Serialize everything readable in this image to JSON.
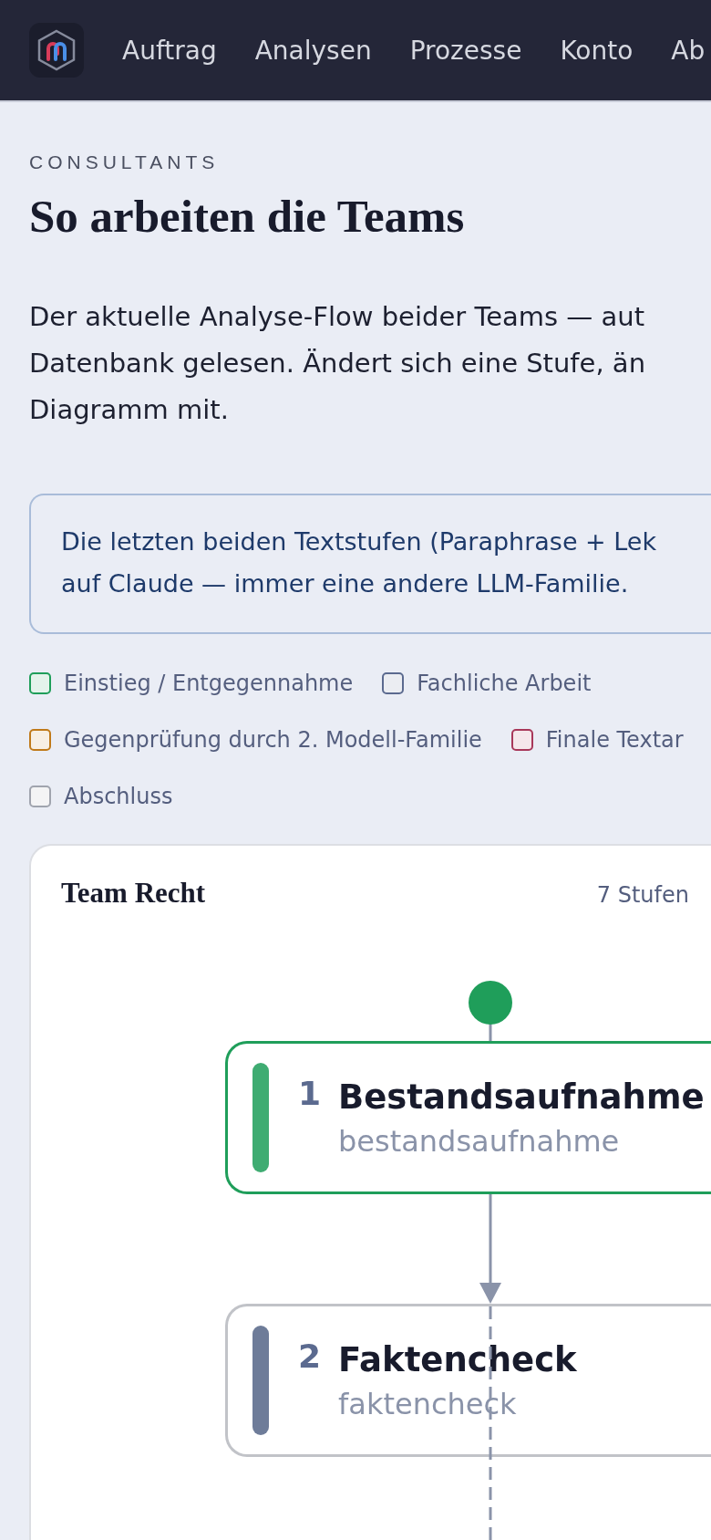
{
  "nav": {
    "items": [
      "Auftrag",
      "Analysen",
      "Prozesse",
      "Konto",
      "Ab"
    ]
  },
  "eyebrow": "CONSULTANTS",
  "title": "So arbeiten die Teams",
  "intro": [
    "Der aktuelle Analyse-Flow beider Teams — aut",
    "Datenbank gelesen. Ändert sich eine Stufe, än",
    "Diagramm mit."
  ],
  "callout": [
    "Die letzten beiden Textstufen (Paraphrase + Lek",
    "auf Claude — immer eine andere LLM-Familie."
  ],
  "legend": [
    {
      "label": "Einstieg / Entgegennahme",
      "color": "#1f9e5a"
    },
    {
      "label": "Fachliche Arbeit",
      "color": "#5b6a8f"
    },
    {
      "label": "Gegenprüfung durch 2. Modell-Familie",
      "color": "#c07a1a"
    },
    {
      "label": "Finale Textar",
      "color": "#a8385a"
    },
    {
      "label": "Abschluss",
      "color": "#a0a4ae"
    }
  ],
  "team": {
    "name": "Team Recht",
    "summary": "7 Stufen",
    "steps": [
      {
        "number": "1",
        "title": "Bestandsaufnahme",
        "key": "bestandsaufnahme",
        "kind": "entry"
      },
      {
        "number": "2",
        "title": "Faktencheck",
        "key": "faktencheck",
        "kind": "work"
      }
    ]
  }
}
